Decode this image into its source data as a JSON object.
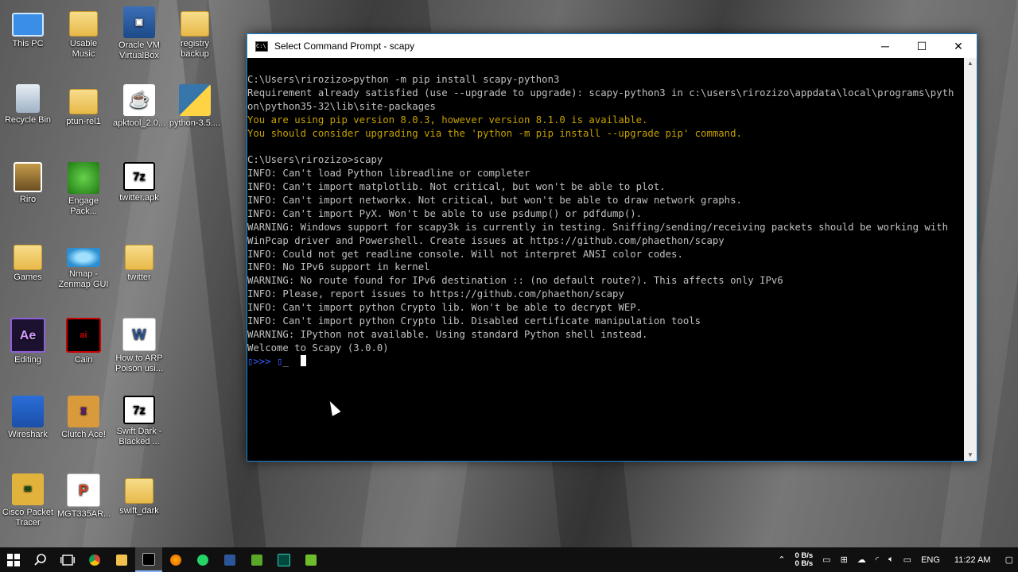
{
  "desktop": {
    "icons": [
      {
        "label": "This PC",
        "icon": "computer-icon"
      },
      {
        "label": "Usable Music",
        "icon": "folder-icon"
      },
      {
        "label": "Oracle VM VirtualBox",
        "icon": "virtualbox-icon"
      },
      {
        "label": "registry backup",
        "icon": "folder-icon"
      },
      {
        "label": "Recycle Bin",
        "icon": "recycle-bin-icon"
      },
      {
        "label": "ptun-rel1",
        "icon": "folder-icon"
      },
      {
        "label": "apktool_2.0...",
        "icon": "java-icon"
      },
      {
        "label": "python-3.5....",
        "icon": "python-icon"
      },
      {
        "label": "Riro",
        "icon": "picture-icon"
      },
      {
        "label": "Engage Pack...",
        "icon": "engage-icon"
      },
      {
        "label": "twitter.apk",
        "icon": "7zip-icon"
      },
      {
        "label": "Games",
        "icon": "folder-icon"
      },
      {
        "label": "Nmap - Zenmap GUI",
        "icon": "nmap-eye-icon"
      },
      {
        "label": "twitter",
        "icon": "folder-icon"
      },
      {
        "label": "Editing",
        "icon": "after-effects-icon"
      },
      {
        "label": "Cain",
        "icon": "cain-icon"
      },
      {
        "label": "How to ARP Poison usi...",
        "icon": "word-doc-icon"
      },
      {
        "label": "Wireshark",
        "icon": "wireshark-icon"
      },
      {
        "label": "Clutch Ace!",
        "icon": "clutch-icon"
      },
      {
        "label": "Swift Dark - Blacked ...",
        "icon": "7zip-icon"
      },
      {
        "label": "Cisco Packet Tracer",
        "icon": "cisco-icon"
      },
      {
        "label": "MGT335AR...",
        "icon": "powerpoint-icon"
      },
      {
        "label": "swift_dark",
        "icon": "folder-icon"
      }
    ]
  },
  "window": {
    "title": "Select Command Prompt - scapy",
    "minimize": "─",
    "maximize": "☐",
    "close": "✕",
    "lines": [
      {
        "text": "C:\\Users\\rirozizo>python -m pip install scapy-python3",
        "color": "gray"
      },
      {
        "text": "Requirement already satisfied (use --upgrade to upgrade): scapy-python3 in c:\\users\\rirozizo\\appdata\\local\\programs\\pyth",
        "color": "gray"
      },
      {
        "text": "on\\python35-32\\lib\\site-packages",
        "color": "gray"
      },
      {
        "text": "You are using pip version 8.0.3, however version 8.1.0 is available.",
        "color": "yellow"
      },
      {
        "text": "You should consider upgrading via the 'python -m pip install --upgrade pip' command.",
        "color": "yellow"
      },
      {
        "text": "",
        "color": "gray"
      },
      {
        "text": "C:\\Users\\rirozizo>scapy",
        "color": "gray"
      },
      {
        "text": "INFO: Can't load Python libreadline or completer",
        "color": "gray"
      },
      {
        "text": "INFO: Can't import matplotlib. Not critical, but won't be able to plot.",
        "color": "gray"
      },
      {
        "text": "INFO: Can't import networkx. Not critical, but won't be able to draw network graphs.",
        "color": "gray"
      },
      {
        "text": "INFO: Can't import PyX. Won't be able to use psdump() or pdfdump().",
        "color": "gray"
      },
      {
        "text": "WARNING: Windows support for scapy3k is currently in testing. Sniffing/sending/receiving packets should be working with",
        "color": "gray"
      },
      {
        "text": "WinPcap driver and Powershell. Create issues at https://github.com/phaethon/scapy",
        "color": "gray"
      },
      {
        "text": "INFO: Could not get readline console. Will not interpret ANSI color codes.",
        "color": "gray"
      },
      {
        "text": "INFO: No IPv6 support in kernel",
        "color": "gray"
      },
      {
        "text": "WARNING: No route found for IPv6 destination :: (no default route?). This affects only IPv6",
        "color": "gray"
      },
      {
        "text": "INFO: Please, report issues to https://github.com/phaethon/scapy",
        "color": "gray"
      },
      {
        "text": "INFO: Can't import python Crypto lib. Won't be able to decrypt WEP.",
        "color": "gray"
      },
      {
        "text": "INFO: Can't import python Crypto lib. Disabled certificate manipulation tools",
        "color": "gray"
      },
      {
        "text": "WARNING: IPython not available. Using standard Python shell instead.",
        "color": "gray"
      },
      {
        "text": "Welcome to Scapy (3.0.0)",
        "color": "gray"
      }
    ],
    "prompt": ">>>"
  },
  "taskbar": {
    "start_icon": "windows-start-icon",
    "apps": [
      "search-icon",
      "task-view-icon",
      "chrome-icon",
      "file-explorer-icon",
      "command-prompt-icon",
      "firefox-icon",
      "whatsapp-icon",
      "word-icon",
      "camtasia-icon",
      "audition-icon",
      "camtasia-recorder-icon"
    ],
    "net_up": "0 B/s",
    "net_down": "0 B/s",
    "language": "ENG",
    "time": "11:22 AM"
  },
  "colors": {
    "console_text": "#c0c0c0",
    "console_warning": "#c4a000",
    "accent": "#1883d7"
  }
}
